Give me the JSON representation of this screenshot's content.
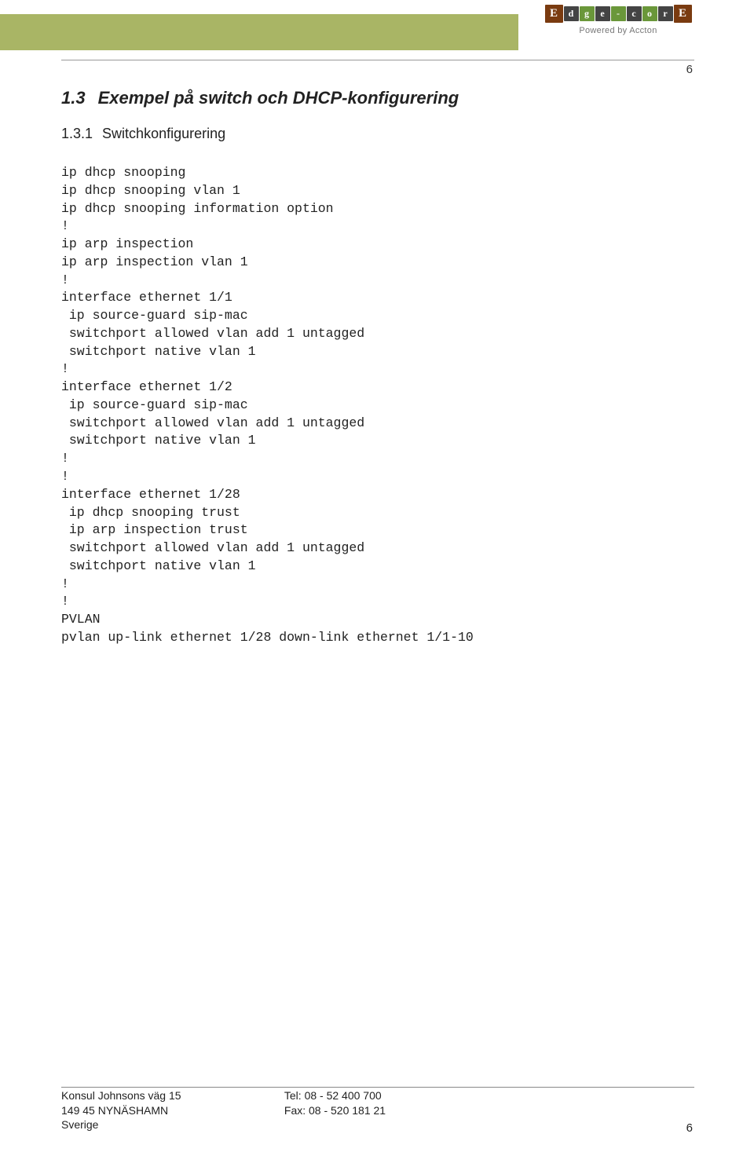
{
  "pagenum": "6",
  "section": {
    "num": "1.3",
    "title": "Exempel på switch och DHCP-konfigurering"
  },
  "subsection": {
    "num": "1.3.1",
    "title": "Switchkonfigurering"
  },
  "code": "ip dhcp snooping\nip dhcp snooping vlan 1\nip dhcp snooping information option\n!\nip arp inspection\nip arp inspection vlan 1\n!\ninterface ethernet 1/1\n ip source-guard sip-mac\n switchport allowed vlan add 1 untagged\n switchport native vlan 1\n!\ninterface ethernet 1/2\n ip source-guard sip-mac\n switchport allowed vlan add 1 untagged\n switchport native vlan 1\n!\n!\ninterface ethernet 1/28\n ip dhcp snooping trust\n ip arp inspection trust\n switchport allowed vlan add 1 untagged\n switchport native vlan 1\n!\n!\nPVLAN\npvlan up-link ethernet 1/28 down-link ethernet 1/1-10",
  "footer": {
    "addr1": "Konsul Johnsons väg 15",
    "addr2": "149 45 NYNÄSHAMN",
    "addr3": "Sverige",
    "tel": "Tel: 08 - 52 400 700",
    "fax": "Fax: 08 - 520 181 21"
  },
  "logo": {
    "letters": [
      "E",
      "d",
      "g",
      "e",
      "-",
      "c",
      "o",
      "r",
      "E"
    ],
    "sub": "Powered by Accton"
  }
}
